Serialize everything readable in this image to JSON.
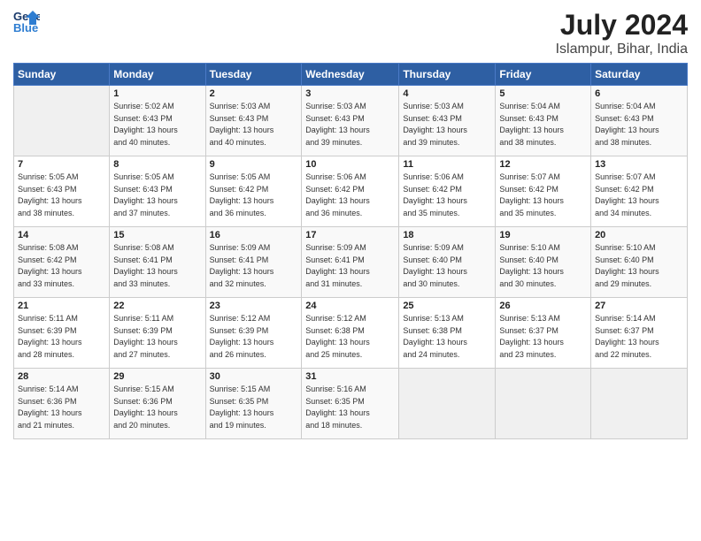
{
  "header": {
    "logo_line1": "General",
    "logo_line2": "Blue",
    "title": "July 2024",
    "subtitle": "Islampur, Bihar, India"
  },
  "days_of_week": [
    "Sunday",
    "Monday",
    "Tuesday",
    "Wednesday",
    "Thursday",
    "Friday",
    "Saturday"
  ],
  "weeks": [
    [
      {
        "day": "",
        "info": ""
      },
      {
        "day": "1",
        "info": "Sunrise: 5:02 AM\nSunset: 6:43 PM\nDaylight: 13 hours\nand 40 minutes."
      },
      {
        "day": "2",
        "info": "Sunrise: 5:03 AM\nSunset: 6:43 PM\nDaylight: 13 hours\nand 40 minutes."
      },
      {
        "day": "3",
        "info": "Sunrise: 5:03 AM\nSunset: 6:43 PM\nDaylight: 13 hours\nand 39 minutes."
      },
      {
        "day": "4",
        "info": "Sunrise: 5:03 AM\nSunset: 6:43 PM\nDaylight: 13 hours\nand 39 minutes."
      },
      {
        "day": "5",
        "info": "Sunrise: 5:04 AM\nSunset: 6:43 PM\nDaylight: 13 hours\nand 38 minutes."
      },
      {
        "day": "6",
        "info": "Sunrise: 5:04 AM\nSunset: 6:43 PM\nDaylight: 13 hours\nand 38 minutes."
      }
    ],
    [
      {
        "day": "7",
        "info": "Sunrise: 5:05 AM\nSunset: 6:43 PM\nDaylight: 13 hours\nand 38 minutes."
      },
      {
        "day": "8",
        "info": "Sunrise: 5:05 AM\nSunset: 6:43 PM\nDaylight: 13 hours\nand 37 minutes."
      },
      {
        "day": "9",
        "info": "Sunrise: 5:05 AM\nSunset: 6:42 PM\nDaylight: 13 hours\nand 36 minutes."
      },
      {
        "day": "10",
        "info": "Sunrise: 5:06 AM\nSunset: 6:42 PM\nDaylight: 13 hours\nand 36 minutes."
      },
      {
        "day": "11",
        "info": "Sunrise: 5:06 AM\nSunset: 6:42 PM\nDaylight: 13 hours\nand 35 minutes."
      },
      {
        "day": "12",
        "info": "Sunrise: 5:07 AM\nSunset: 6:42 PM\nDaylight: 13 hours\nand 35 minutes."
      },
      {
        "day": "13",
        "info": "Sunrise: 5:07 AM\nSunset: 6:42 PM\nDaylight: 13 hours\nand 34 minutes."
      }
    ],
    [
      {
        "day": "14",
        "info": "Sunrise: 5:08 AM\nSunset: 6:42 PM\nDaylight: 13 hours\nand 33 minutes."
      },
      {
        "day": "15",
        "info": "Sunrise: 5:08 AM\nSunset: 6:41 PM\nDaylight: 13 hours\nand 33 minutes."
      },
      {
        "day": "16",
        "info": "Sunrise: 5:09 AM\nSunset: 6:41 PM\nDaylight: 13 hours\nand 32 minutes."
      },
      {
        "day": "17",
        "info": "Sunrise: 5:09 AM\nSunset: 6:41 PM\nDaylight: 13 hours\nand 31 minutes."
      },
      {
        "day": "18",
        "info": "Sunrise: 5:09 AM\nSunset: 6:40 PM\nDaylight: 13 hours\nand 30 minutes."
      },
      {
        "day": "19",
        "info": "Sunrise: 5:10 AM\nSunset: 6:40 PM\nDaylight: 13 hours\nand 30 minutes."
      },
      {
        "day": "20",
        "info": "Sunrise: 5:10 AM\nSunset: 6:40 PM\nDaylight: 13 hours\nand 29 minutes."
      }
    ],
    [
      {
        "day": "21",
        "info": "Sunrise: 5:11 AM\nSunset: 6:39 PM\nDaylight: 13 hours\nand 28 minutes."
      },
      {
        "day": "22",
        "info": "Sunrise: 5:11 AM\nSunset: 6:39 PM\nDaylight: 13 hours\nand 27 minutes."
      },
      {
        "day": "23",
        "info": "Sunrise: 5:12 AM\nSunset: 6:39 PM\nDaylight: 13 hours\nand 26 minutes."
      },
      {
        "day": "24",
        "info": "Sunrise: 5:12 AM\nSunset: 6:38 PM\nDaylight: 13 hours\nand 25 minutes."
      },
      {
        "day": "25",
        "info": "Sunrise: 5:13 AM\nSunset: 6:38 PM\nDaylight: 13 hours\nand 24 minutes."
      },
      {
        "day": "26",
        "info": "Sunrise: 5:13 AM\nSunset: 6:37 PM\nDaylight: 13 hours\nand 23 minutes."
      },
      {
        "day": "27",
        "info": "Sunrise: 5:14 AM\nSunset: 6:37 PM\nDaylight: 13 hours\nand 22 minutes."
      }
    ],
    [
      {
        "day": "28",
        "info": "Sunrise: 5:14 AM\nSunset: 6:36 PM\nDaylight: 13 hours\nand 21 minutes."
      },
      {
        "day": "29",
        "info": "Sunrise: 5:15 AM\nSunset: 6:36 PM\nDaylight: 13 hours\nand 20 minutes."
      },
      {
        "day": "30",
        "info": "Sunrise: 5:15 AM\nSunset: 6:35 PM\nDaylight: 13 hours\nand 19 minutes."
      },
      {
        "day": "31",
        "info": "Sunrise: 5:16 AM\nSunset: 6:35 PM\nDaylight: 13 hours\nand 18 minutes."
      },
      {
        "day": "",
        "info": ""
      },
      {
        "day": "",
        "info": ""
      },
      {
        "day": "",
        "info": ""
      }
    ]
  ]
}
